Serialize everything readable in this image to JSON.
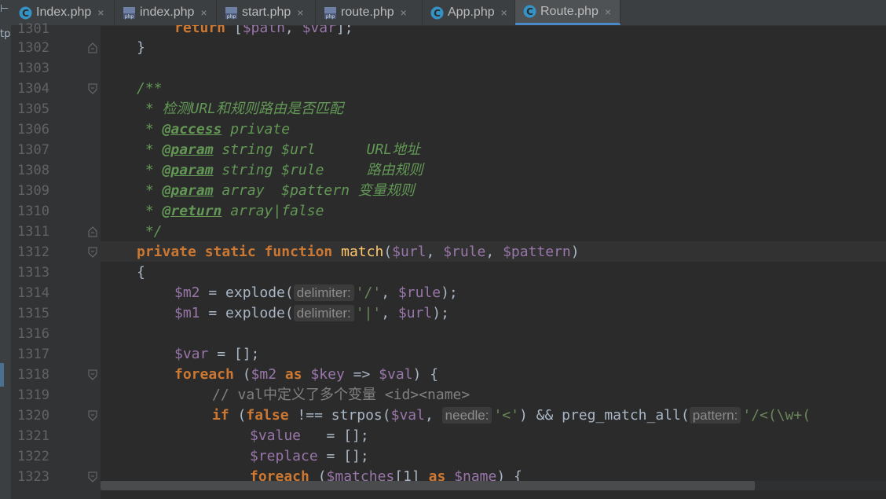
{
  "tabs": [
    {
      "label": "Index.php",
      "icon": "php-class-icon",
      "active": false
    },
    {
      "label": "index.php",
      "icon": "php-file-icon",
      "active": false
    },
    {
      "label": "start.php",
      "icon": "php-file-icon",
      "active": false
    },
    {
      "label": "route.php",
      "icon": "php-file-icon",
      "active": false
    },
    {
      "label": "App.php",
      "icon": "php-class-icon",
      "active": false
    },
    {
      "label": "Route.php",
      "icon": "php-class-icon",
      "active": true
    }
  ],
  "tab_close_glyph": "×",
  "left_strip_labels": [
    "⊢",
    "tp"
  ],
  "line_numbers": [
    "1301",
    "1302",
    "1303",
    "1304",
    "1305",
    "1306",
    "1307",
    "1308",
    "1309",
    "1310",
    "1311",
    "1312",
    "1313",
    "1314",
    "1315",
    "1316",
    "1317",
    "1318",
    "1319",
    "1320",
    "1321",
    "1322",
    "1323"
  ],
  "code": {
    "l1301": {
      "kw": "return",
      "rest1": " [",
      "v1": "$path",
      "rest2": ", ",
      "v2": "$var",
      "rest3": "];"
    },
    "l1302": "}",
    "l1304": "/**",
    "l1305": " * 检测URL和规则路由是否匹配",
    "l1306": {
      "star": " * ",
      "tag": "@access",
      "rest": " private"
    },
    "l1307": {
      "star": " * ",
      "tag": "@param",
      "rest": " string $url      URL地址"
    },
    "l1308": {
      "star": " * ",
      "tag": "@param",
      "rest": " string $rule     路由规则"
    },
    "l1309": {
      "star": " * ",
      "tag": "@param",
      "rest": " array  $pattern 变量规则"
    },
    "l1310": {
      "star": " * ",
      "tag": "@return",
      "rest": " array|false"
    },
    "l1311": " */",
    "l1312": {
      "k1": "private",
      "k2": "static",
      "k3": "function",
      "name": "match",
      "p1": "$url",
      "p2": "$rule",
      "p3": "$pattern"
    },
    "l1313": "{",
    "l1314": {
      "v": "$m2",
      "op": " = explode(",
      "hint": "delimiter:",
      "s": "'/'",
      "sep": ", ",
      "a": "$rule",
      "end": ");"
    },
    "l1315": {
      "v": "$m1",
      "op": " = explode(",
      "hint": "delimiter:",
      "s": "'|'",
      "sep": ", ",
      "a": "$url",
      "end": ");"
    },
    "l1317": {
      "v": "$var",
      "rest": " = [];"
    },
    "l1318": {
      "kw": "foreach",
      "o": " (",
      "a": "$m2",
      "as": "as",
      "k": "$key",
      "arrow": " => ",
      "val": "$val",
      "end": ") {"
    },
    "l1319": "// val中定义了多个变量 <id><name>",
    "l1320": {
      "kw": "if",
      "o": " (",
      "f": "false",
      "ne": " !== strpos(",
      "v": "$val",
      "sep": ", ",
      "hint1": "needle:",
      "s1": "'<'",
      "mid": ") && preg_match_all(",
      "hint2": "pattern:",
      "s2": "'/<(\\w+("
    },
    "l1321": {
      "v": "$value",
      "rest": "   = [];"
    },
    "l1322": {
      "v": "$replace",
      "rest": " = [];"
    },
    "l1323": {
      "kw": "foreach",
      "o": " (",
      "m": "$matches",
      "idx": "[1] ",
      "as": "as",
      "n": "$name",
      "end": ") {"
    }
  }
}
